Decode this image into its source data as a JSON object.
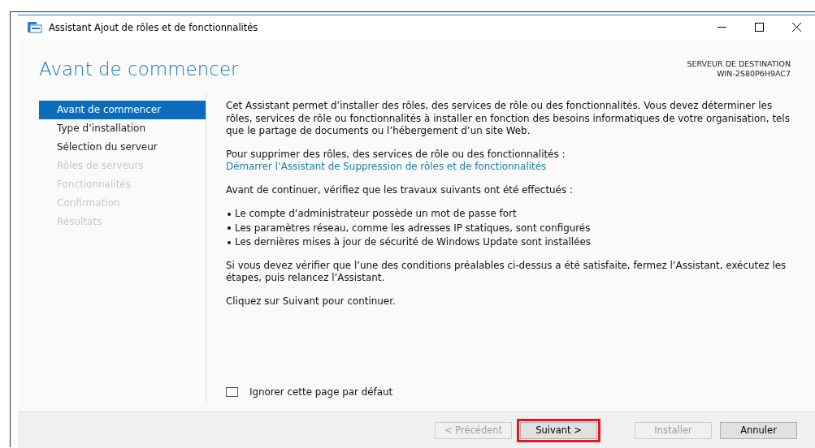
{
  "window": {
    "title": "Assistant Ajout de rôles et de fonctionnalités"
  },
  "header": {
    "title": "Avant de commencer",
    "server_label": "SERVEUR DE DESTINATION",
    "server_name": "WIN-2S80P6H9AC7"
  },
  "sidebar": {
    "items": [
      {
        "label": "Avant de commencer",
        "selected": true,
        "disabled": false
      },
      {
        "label": "Type d’installation",
        "selected": false,
        "disabled": false
      },
      {
        "label": "Sélection du serveur",
        "selected": false,
        "disabled": false
      },
      {
        "label": "Rôles de serveurs",
        "selected": false,
        "disabled": true
      },
      {
        "label": "Fonctionnalités",
        "selected": false,
        "disabled": true
      },
      {
        "label": "Confirmation",
        "selected": false,
        "disabled": true
      },
      {
        "label": "Résultats",
        "selected": false,
        "disabled": true
      }
    ]
  },
  "content": {
    "blocks": [
      {
        "kind": "paragraph",
        "text": "Cet Assistant permet d’installer des rôles, des services de rôle ou des fonctionnalités. Vous devez déterminer les rôles, services de rôle ou fonctionnalités à installer en fonction des besoins informatiques de votre organisation, tels que le partage de documents ou l’hébergement d’un site Web."
      },
      {
        "kind": "paragraph_link",
        "text": "Pour supprimer des rôles, des services de rôle ou des fonctionnalités :",
        "link": "Démarrer l’Assistant de Suppression de rôles et de fonctionnalités"
      },
      {
        "kind": "paragraph",
        "text": "Avant de continuer, vérifiez que les travaux suivants ont été effectués :"
      },
      {
        "kind": "bullets",
        "items": [
          "Le compte d’administrateur possède un mot de passe fort",
          "Les paramètres réseau, comme les adresses IP statiques, sont configurés",
          "Les dernières mises à jour de sécurité de Windows Update sont installées"
        ]
      },
      {
        "kind": "paragraph",
        "text": "Si vous devez vérifier que l’une des conditions préalables ci-dessus a été satisfaite, fermez l’Assistant, exécutez les étapes, puis relancez l’Assistant."
      },
      {
        "kind": "paragraph",
        "text": "Cliquez sur Suivant pour continuer."
      }
    ],
    "skip_checkbox": {
      "label": "Ignorer cette page par défaut",
      "checked": false
    }
  },
  "buttons": [
    {
      "label": "< Précédent",
      "disabled": true,
      "highlighted": false
    },
    {
      "label": "Suivant >",
      "disabled": false,
      "highlighted": true
    },
    {
      "label": "Installer",
      "disabled": true,
      "highlighted": false
    },
    {
      "label": "Annuler",
      "disabled": false,
      "highlighted": false
    }
  ]
}
